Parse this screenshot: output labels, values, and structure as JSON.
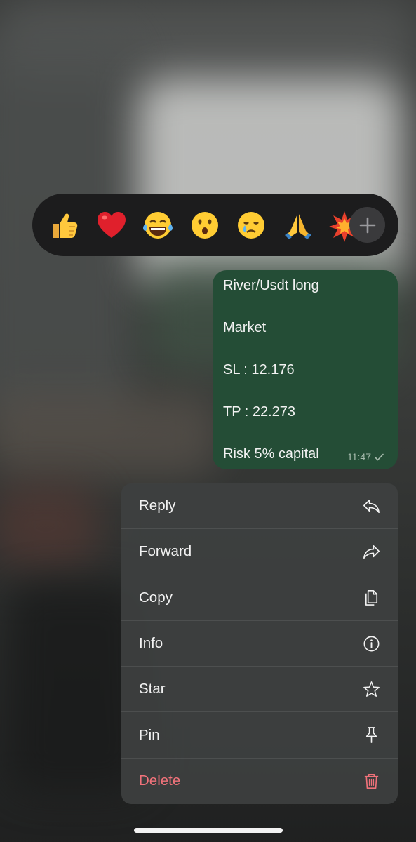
{
  "reactions": {
    "emojis": [
      "👍",
      "❤️",
      "😂",
      "😮",
      "😢",
      "🙏",
      "💥"
    ],
    "more_icon": "plus-icon"
  },
  "message": {
    "lines": [
      "River/Usdt long",
      "Market",
      "SL : 12.176",
      "TP : 22.273",
      "Risk 5% capital"
    ],
    "time": "11:47",
    "status_icon": "check-icon",
    "bubble_color": "#244d36"
  },
  "menu": {
    "items": [
      {
        "label": "Reply",
        "icon": "reply-icon"
      },
      {
        "label": "Forward",
        "icon": "forward-icon"
      },
      {
        "label": "Copy",
        "icon": "copy-icon"
      },
      {
        "label": "Info",
        "icon": "info-icon"
      },
      {
        "label": "Star",
        "icon": "star-icon"
      },
      {
        "label": "Pin",
        "icon": "pin-icon"
      },
      {
        "label": "Delete",
        "icon": "trash-icon"
      }
    ],
    "danger_color": "#f0727a"
  }
}
